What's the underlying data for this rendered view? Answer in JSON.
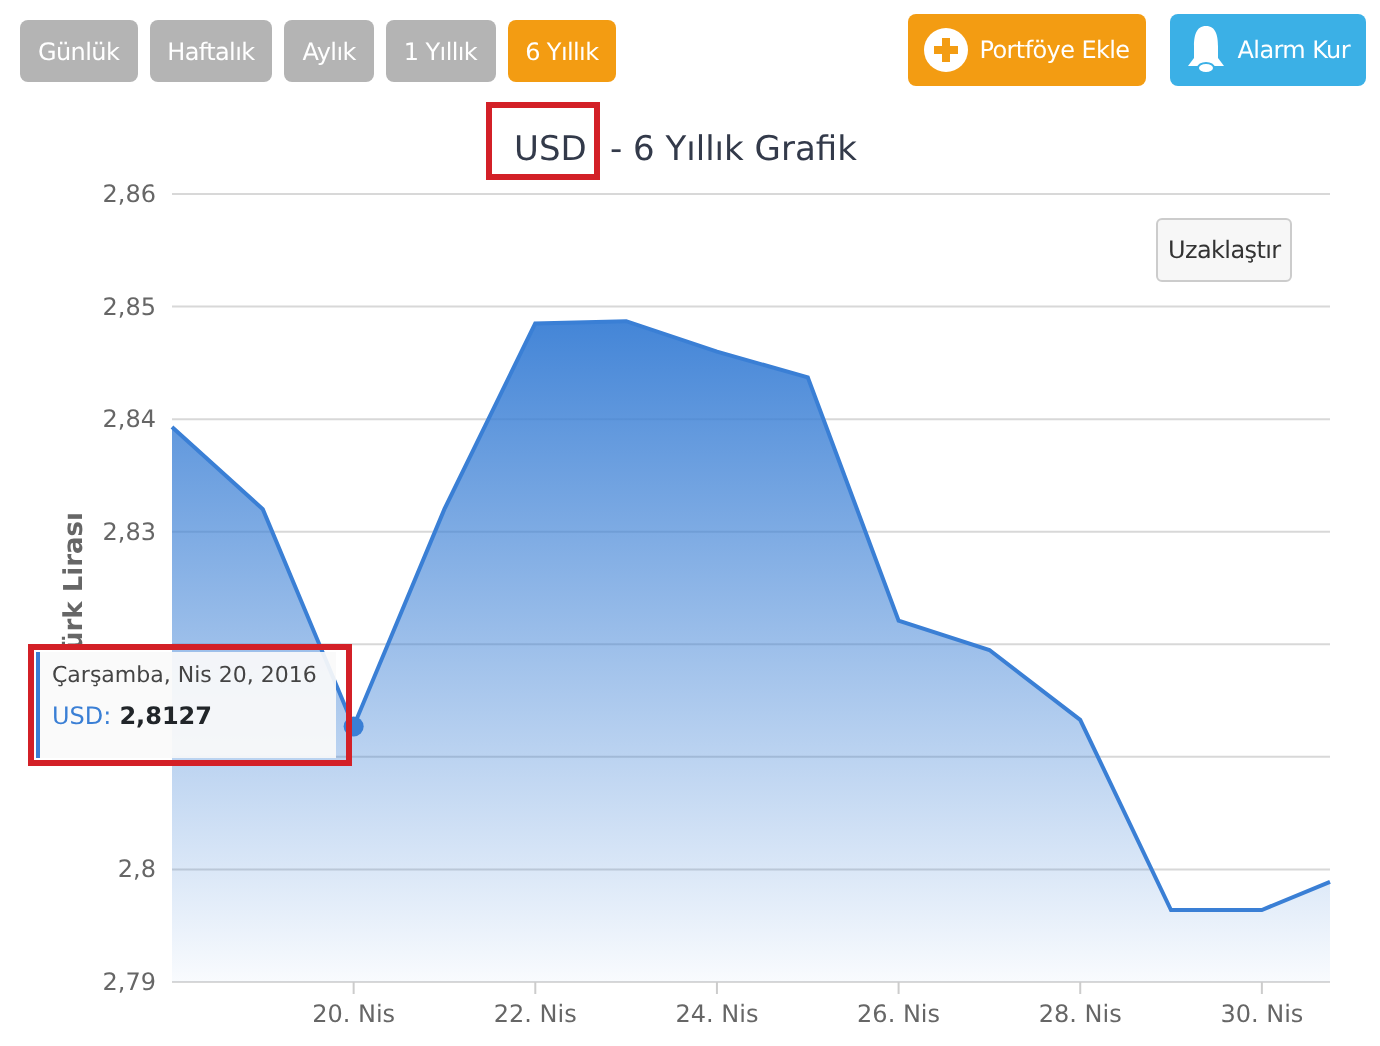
{
  "range_tabs": [
    {
      "label": "Günlük",
      "selected": false
    },
    {
      "label": "Haftalık",
      "selected": false
    },
    {
      "label": "Aylık",
      "selected": false
    },
    {
      "label": "1 Yıllık",
      "selected": false
    },
    {
      "label": "6 Yıllık",
      "selected": true
    }
  ],
  "actions": [
    {
      "kind": "add",
      "label": "Portföye Ekle"
    },
    {
      "kind": "alarm",
      "label": "Alarm Kur"
    }
  ],
  "chart": {
    "title_currency": "USD",
    "title_rest": "- 6 Yıllık Grafik",
    "currency_highlighted": true,
    "zoom_button": "Uzaklaştır",
    "tooltip": {
      "date": "Çarşamba, Nis 20, 2016",
      "separator": ":",
      "value": "2,8127",
      "highlighted": true
    },
    "chart_data": {
      "type": "area",
      "grid": true,
      "ylabel": "ürk Lirası",
      "xlim": [
        18,
        30.75
      ],
      "ylim": [
        2.79,
        2.86
      ],
      "x": [
        18,
        19,
        20,
        21,
        22,
        23,
        24,
        25,
        26,
        27,
        28,
        29,
        30,
        30.75
      ],
      "series": [
        {
          "name": "USD",
          "color": "#3a7fd5",
          "values": [
            2.8393,
            2.832,
            2.8127,
            2.832,
            2.8485,
            2.8487,
            2.846,
            2.8437,
            2.8221,
            2.8195,
            2.8133,
            2.7964,
            2.7964,
            2.7989
          ]
        }
      ],
      "xticks": [
        {
          "value": 20,
          "label": "20. Nis"
        },
        {
          "value": 22,
          "label": "22. Nis"
        },
        {
          "value": 24,
          "label": "24. Nis"
        },
        {
          "value": 26,
          "label": "26. Nis"
        },
        {
          "value": 28,
          "label": "28. Nis"
        },
        {
          "value": 30,
          "label": "30. Nis"
        }
      ],
      "yticks": [
        {
          "value": 2.79,
          "label": "2,79"
        },
        {
          "value": 2.8,
          "label": "2,8"
        },
        {
          "value": 2.83,
          "label": "2,83"
        },
        {
          "value": 2.84,
          "label": "2,84"
        },
        {
          "value": 2.85,
          "label": "2,85"
        },
        {
          "value": 2.86,
          "label": "2,86"
        }
      ]
    }
  }
}
